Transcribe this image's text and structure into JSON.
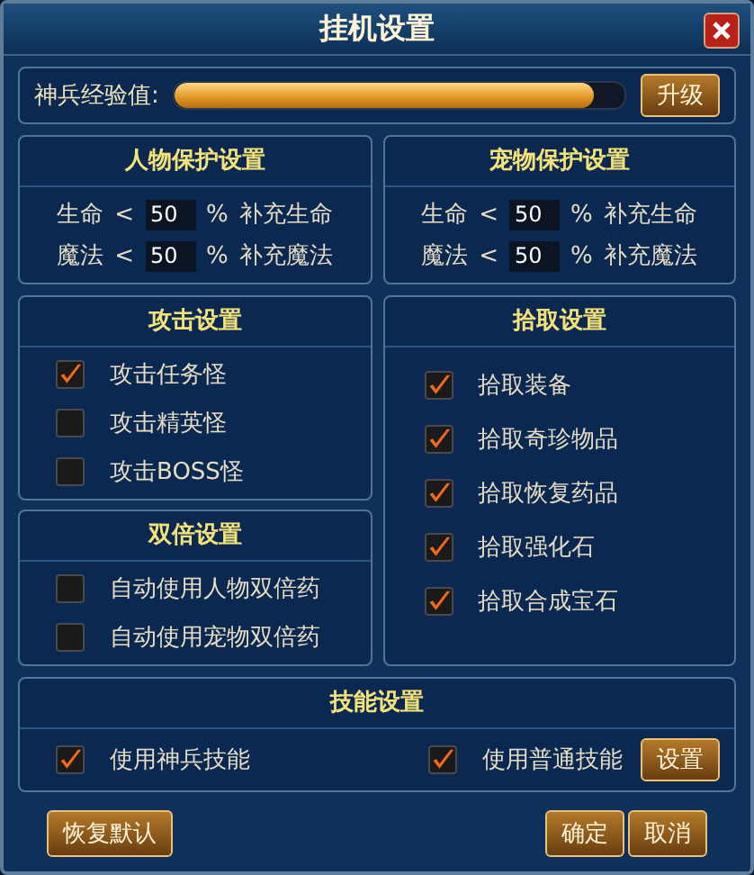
{
  "window": {
    "title": "挂机设置"
  },
  "experience": {
    "label": "神兵经验值:",
    "level": 0.93,
    "button": "升级"
  },
  "protection": [
    {
      "title": "人物保护设置",
      "rows": [
        {
          "label": "生命",
          "sign": "<",
          "value": "50",
          "unit": "%",
          "action": "补充生命"
        },
        {
          "label": "魔法",
          "sign": "<",
          "value": "50",
          "unit": "%",
          "action": "补充魔法"
        }
      ]
    },
    {
      "title": "宠物保护设置",
      "rows": [
        {
          "label": "生命",
          "sign": "<",
          "value": "50",
          "unit": "%",
          "action": "补充生命"
        },
        {
          "label": "魔法",
          "sign": "<",
          "value": "50",
          "unit": "%",
          "action": "补充魔法"
        }
      ]
    }
  ],
  "attack": {
    "title": "攻击设置",
    "options": [
      {
        "label": "攻击任务怪",
        "checked": true
      },
      {
        "label": "攻击精英怪",
        "checked": false
      },
      {
        "label": "攻击BOSS怪",
        "checked": false
      }
    ]
  },
  "double": {
    "title": "双倍设置",
    "options": [
      {
        "label": "自动使用人物双倍药",
        "checked": false
      },
      {
        "label": "自动使用宠物双倍药",
        "checked": false
      }
    ]
  },
  "pickup": {
    "title": "拾取设置",
    "options": [
      {
        "label": "拾取装备",
        "checked": true
      },
      {
        "label": "拾取奇珍物品",
        "checked": true
      },
      {
        "label": "拾取恢复药品",
        "checked": true
      },
      {
        "label": "拾取强化石",
        "checked": true
      },
      {
        "label": "拾取合成宝石",
        "checked": true
      }
    ]
  },
  "skills": {
    "title": "技能设置",
    "options": [
      {
        "label": "使用神兵技能",
        "checked": true
      },
      {
        "label": "使用普通技能",
        "checked": true
      }
    ],
    "button": "设置"
  },
  "buttons": {
    "left": "恢复默认",
    "right": [
      "确定",
      "取消"
    ]
  }
}
